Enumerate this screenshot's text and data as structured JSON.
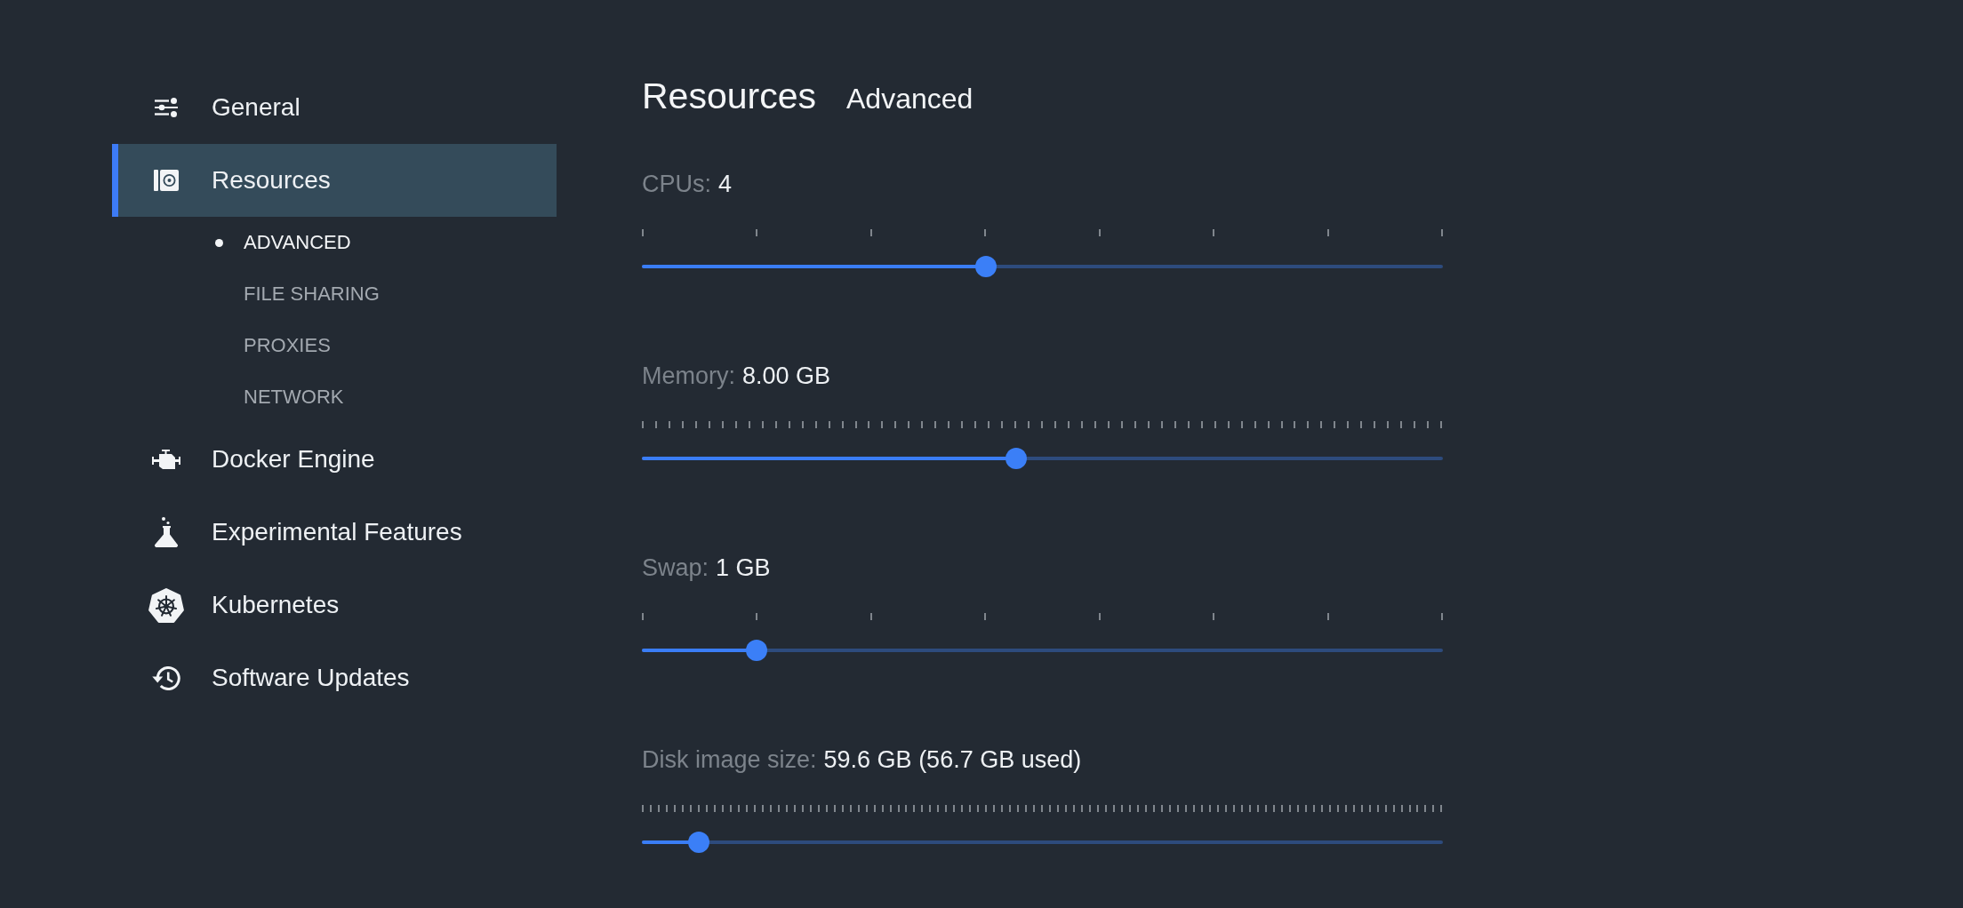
{
  "sidebar": {
    "items": [
      {
        "label": "General",
        "selected": false
      },
      {
        "label": "Resources",
        "selected": true,
        "children": [
          {
            "label": "ADVANCED",
            "selected": true
          },
          {
            "label": "FILE SHARING",
            "selected": false
          },
          {
            "label": "PROXIES",
            "selected": false
          },
          {
            "label": "NETWORK",
            "selected": false
          }
        ]
      },
      {
        "label": "Docker Engine",
        "selected": false
      },
      {
        "label": "Experimental Features",
        "selected": false
      },
      {
        "label": "Kubernetes",
        "selected": false
      },
      {
        "label": "Software Updates",
        "selected": false
      }
    ]
  },
  "header": {
    "title": "Resources",
    "subtitle": "Advanced"
  },
  "settings": [
    {
      "label": "CPUs:",
      "value": "4",
      "kind": "coarse",
      "level": 0.429
    },
    {
      "label": "Memory:",
      "value": "8.00 GB",
      "kind": "fine",
      "level": 0.467
    },
    {
      "label": "Swap:",
      "value": "1 GB",
      "kind": "coarse",
      "level": 0.143
    },
    {
      "label": "Disk image size:",
      "value": "59.6 GB (56.7 GB used)",
      "kind": "dense",
      "level": 0.071
    }
  ]
}
